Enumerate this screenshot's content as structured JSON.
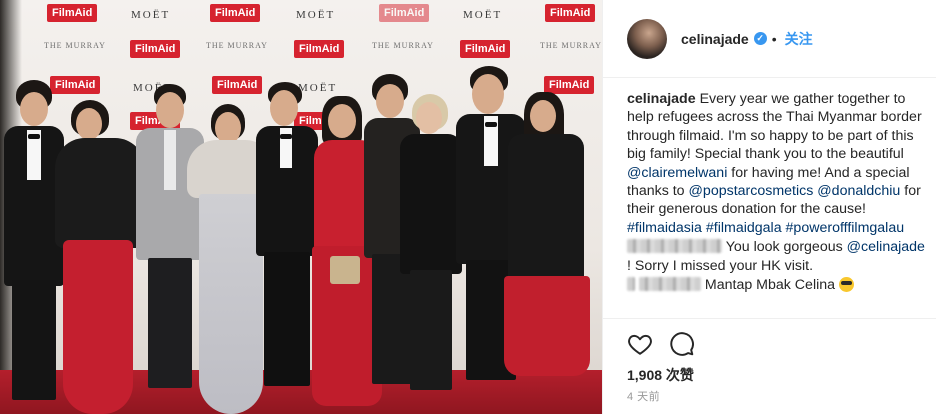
{
  "photo": {
    "sponsors": {
      "filmaid": "FilmAid",
      "moet": "MOËT",
      "murray": "THE MURRAY"
    },
    "colors": {
      "carpet": "#b41f2c",
      "backdrop": "#f4f1ee",
      "filmaid_red": "#d6232f"
    }
  },
  "header": {
    "username": "celinajade",
    "verified_icon": "verified-badge-icon",
    "separator": "•",
    "follow_label": "关注"
  },
  "caption": {
    "username": "celinajade",
    "text_1": "Every year we gather together to help refugees across the Thai Myanmar border through filmaid. I'm so happy to be part of this big family! Special thank you to the beautiful ",
    "mention_1": "@clairemelwani",
    "text_2": " for having me! And a special thanks to ",
    "mention_2": "@popstarcosmetics",
    "text_3": " ",
    "mention_3": "@donaldchiu",
    "text_4": " for their generous donation for the cause! ",
    "hashtag_1": "#filmaidasia",
    "text_5": " ",
    "hashtag_2": "#filmaidgala",
    "text_6": " ",
    "hashtag_3": "#powerofffilmgalau"
  },
  "comments": [
    {
      "text_1": "You look gorgeous ",
      "mention": "@celinajade",
      "text_2": " ! Sorry I missed your HK visit."
    },
    {
      "text_1": "Mantap Mbak Celina ",
      "emoji": "sunglasses-emoji"
    }
  ],
  "actions": {
    "like_icon": "heart-icon",
    "comment_icon": "comment-icon",
    "likes_label": "1,908 次赞",
    "timestamp": "4 天前"
  }
}
